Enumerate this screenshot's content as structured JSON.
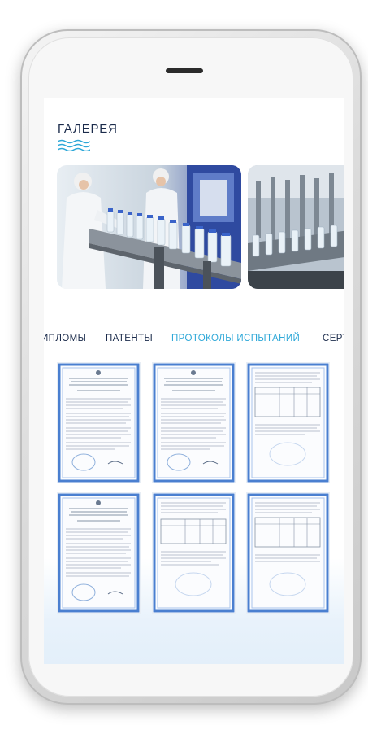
{
  "gallery": {
    "title": "ГАЛЕРЕЯ"
  },
  "tabs": [
    {
      "label": "ИПЛОМЫ",
      "active": false
    },
    {
      "label": "ПАТЕНТЫ",
      "active": false
    },
    {
      "label": "ПРОТОКОЛЫ ИСПЫТАНИЙ",
      "active": true
    },
    {
      "label": "СЕРТ",
      "active": false
    }
  ],
  "colors": {
    "title": "#1b2b4b",
    "accent": "#2ea8d8",
    "doc_border": "#4a7fd0"
  },
  "documents": {
    "count": 6,
    "kind": "certificate-scans"
  }
}
